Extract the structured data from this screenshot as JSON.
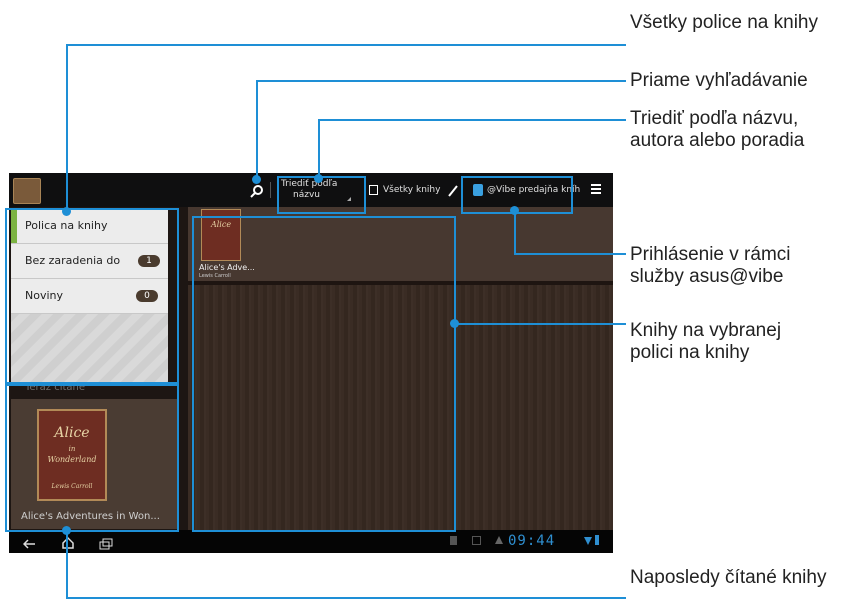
{
  "tablet": {
    "action_bar": {
      "sort_label_line1": "Triediť podľa",
      "sort_label_line2": "názvu",
      "all_books_label": "Všetky knihy",
      "vibe_store_label": "@Vibe predajňa kníh"
    },
    "shelf_menu": {
      "items": [
        {
          "label": "Polica na knihy",
          "count": ""
        },
        {
          "label": "Bez zaradenia do kategórie",
          "count": "1"
        },
        {
          "label": "Noviny",
          "count": "0"
        }
      ]
    },
    "now_reading": {
      "heading": "Teraz čítané",
      "book_title": "Alice's Adventures in Won...",
      "cover_line1": "Alice",
      "cover_line2": "in",
      "cover_line3": "Wonderland",
      "cover_author": "Lewis Carroll"
    },
    "shelf_book": {
      "title": "Alice's Adve...",
      "author": "Lewis Carroll"
    },
    "status_bar": {
      "time": "09:44"
    }
  },
  "callouts": {
    "all_shelves": "Všetky police na knihy",
    "direct_search": "Priame vyhľadávanie",
    "sort": "Triediť podľa názvu, autora alebo poradia",
    "login": "Prihlásenie v rámci služby asus@vibe",
    "books_on_shelf": "Knihy na vybranej polici na knihy",
    "recently_read": "Naposledy čítané knihy"
  },
  "colors": {
    "callout": "#1e8fd6",
    "active_marker": "#7cb342"
  }
}
